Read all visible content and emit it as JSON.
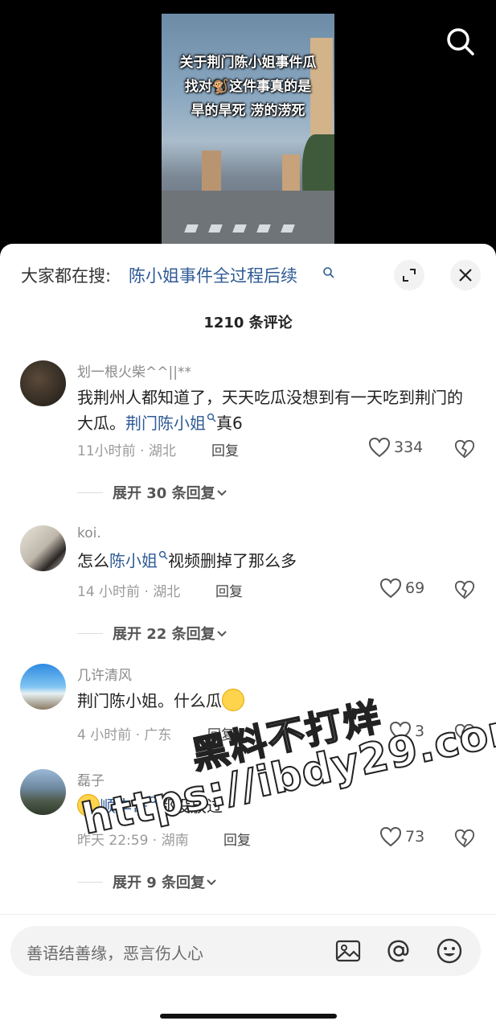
{
  "video": {
    "caption_lines": [
      "关于荆门陈小姐事件瓜",
      "找对🐒这件事真的是",
      "旱的旱死 涝的涝死"
    ]
  },
  "sheet": {
    "everyone_label": "大家都在搜:",
    "hot_search": "陈小姐事件全过程后续",
    "count_title": "1210 条评论"
  },
  "comments": [
    {
      "username": "划一根火柴^^||**",
      "text_before": "我荆州人都知道了，天天吃瓜没想到有一天吃到荆门的大瓜。",
      "tag": "荆门陈小姐",
      "text_after": "真6",
      "meta": "11小时前 · 湖北",
      "reply": "回复",
      "likes": "334",
      "expand": "展开 30 条回复"
    },
    {
      "username": "koi.",
      "text_before": "怎么",
      "tag": "陈小姐",
      "text_after": "视频删掉了那么多",
      "meta": "14 小时前 · 湖北",
      "reply": "回复",
      "likes": "69",
      "expand": "展开 22 条回复"
    },
    {
      "username": "几许清风",
      "text_before": "荆门陈小姐。什么瓜",
      "meta": "4 小时前 · 广东",
      "reply": "回复",
      "likes": "3"
    },
    {
      "username": "磊子",
      "tag": "顺丰哥",
      "text_after": "都没放过",
      "meta": "昨天 22:59 · 湖南",
      "reply": "回复",
      "likes": "73",
      "expand": "展开 9 条回复"
    }
  ],
  "input": {
    "placeholder": "善语结善缘，恶言伤人心"
  },
  "watermark": {
    "line1": "黑料不打烊",
    "line2": "https://ibdy29.com"
  },
  "colors": {
    "link": "#2f5b94",
    "sheet_bg": "#ffffff",
    "input_bg": "#f3f3f3"
  }
}
